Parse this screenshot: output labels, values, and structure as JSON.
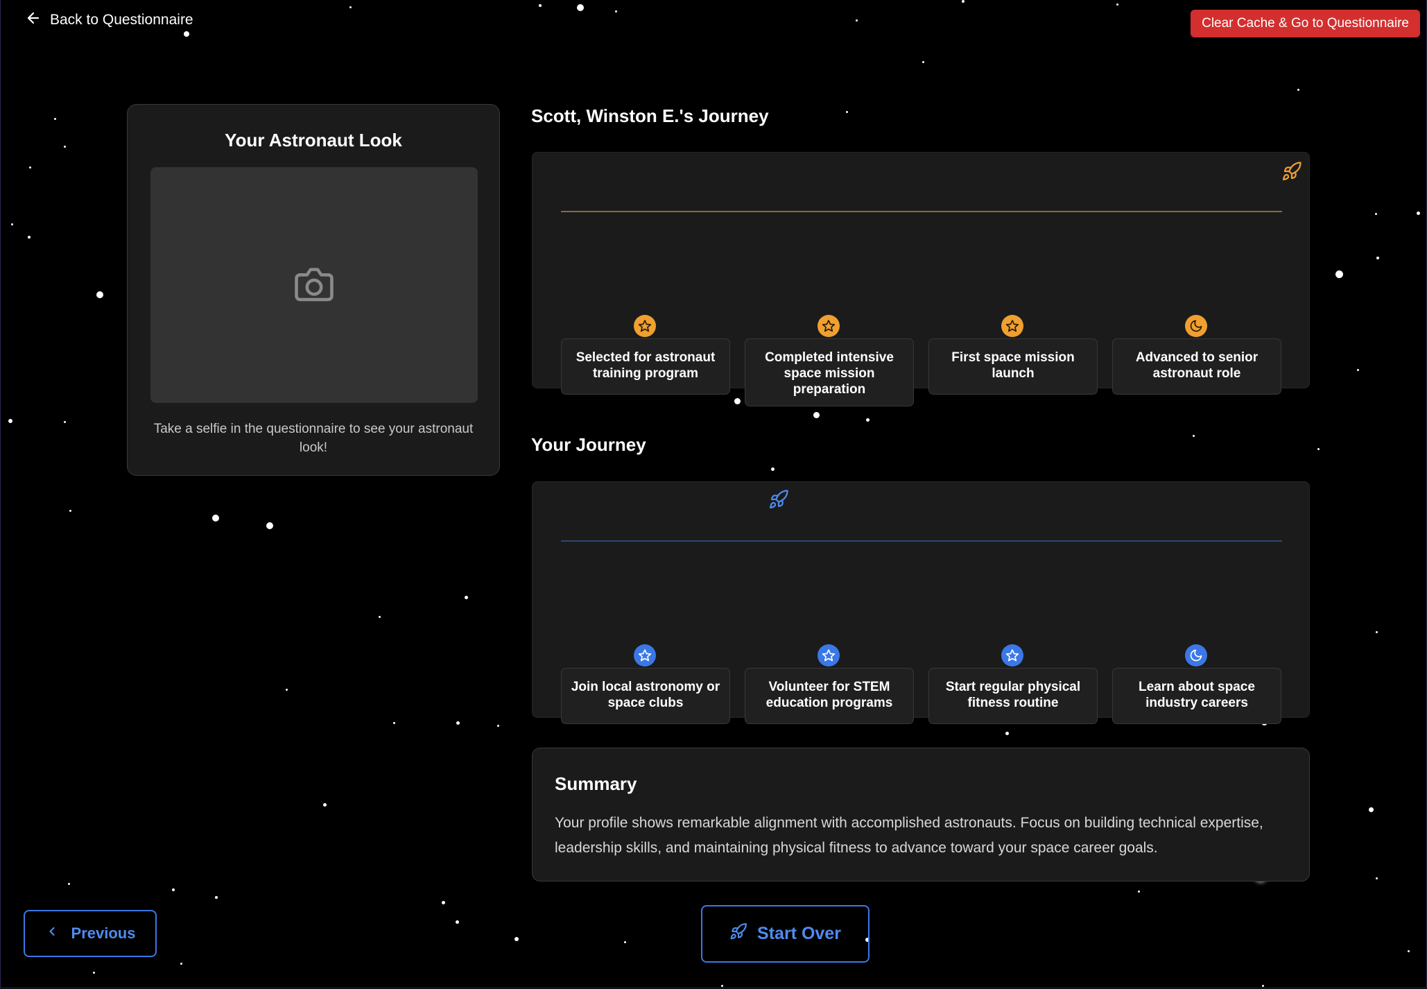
{
  "nav": {
    "back_label": "Back to Questionnaire",
    "clear_label": "Clear Cache & Go to Questionnaire"
  },
  "look": {
    "title": "Your Astronaut Look",
    "icon": "camera-icon",
    "hint": "Take a selfie in the questionnaire to see your astronaut look!"
  },
  "astronaut_journey": {
    "title": "Scott, Winston E.'s Journey",
    "accent": "#f0a030",
    "items": [
      {
        "icon": "star-icon",
        "label": "Selected for astronaut training program"
      },
      {
        "icon": "star-icon",
        "label": "Completed intensive space mission preparation"
      },
      {
        "icon": "star-icon",
        "label": "First space mission launch"
      },
      {
        "icon": "moon-icon",
        "label": "Advanced to senior astronaut role"
      }
    ]
  },
  "your_journey": {
    "title": "Your Journey",
    "accent": "#3b78e7",
    "items": [
      {
        "icon": "star-icon",
        "label": "Join local astronomy or space clubs"
      },
      {
        "icon": "star-icon",
        "label": "Volunteer for STEM education programs"
      },
      {
        "icon": "star-icon",
        "label": "Start regular physical fitness routine"
      },
      {
        "icon": "moon-icon",
        "label": "Learn about space industry careers"
      }
    ]
  },
  "summary": {
    "title": "Summary",
    "text": "Your profile shows remarkable alignment with accomplished astronauts. Focus on building technical expertise, leadership skills, and maintaining physical fitness to advance toward your space career goals."
  },
  "footer": {
    "previous_label": "Previous",
    "start_over_label": "Start Over"
  },
  "colors": {
    "background": "#000000",
    "card": "#1b1b1b",
    "danger": "#d32f2f",
    "primary": "#3b78e7",
    "journey_accent": "#f0a030"
  }
}
